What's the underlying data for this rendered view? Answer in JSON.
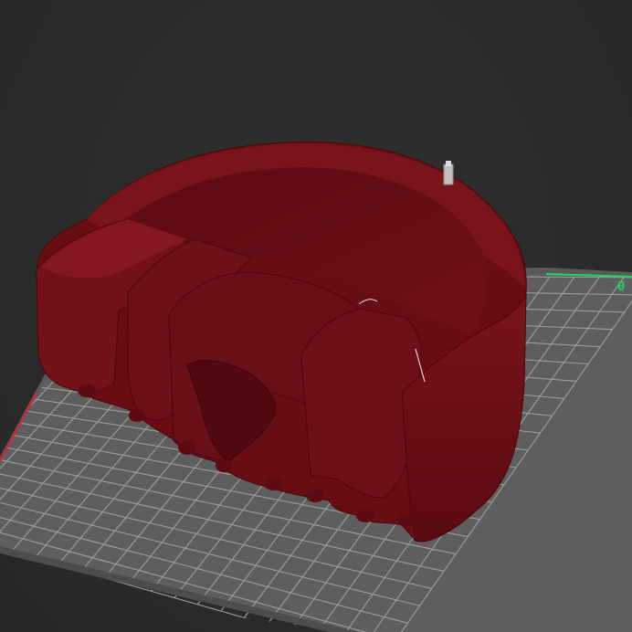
{
  "viewport": {
    "axis_indicator_text": "0"
  },
  "scene": {
    "background_color": "#2b2b2b",
    "bed_color": "#5a5a5a",
    "bed_grid_color": "#9a9a9a",
    "bed_edge_color": "#6a6a6a",
    "model_color": "#6b0e14",
    "model_shadow_color": "#4a070c",
    "model_highlight_color": "#8a1a22",
    "axis_x_color": "#e0202a",
    "axis_y_color": "#1fd65f",
    "accessory_color": "#c8c8c8"
  }
}
